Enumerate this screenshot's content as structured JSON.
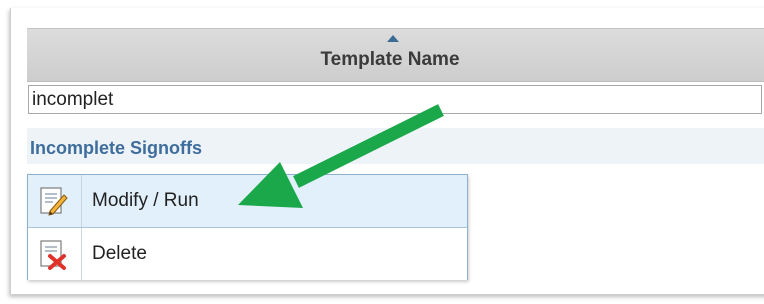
{
  "table": {
    "column_header": "Template Name",
    "sort_direction": "ascending",
    "filter_value": "incomplet",
    "rows": [
      {
        "label": "Incomplete Signoffs"
      }
    ]
  },
  "context_menu": {
    "items": [
      {
        "label": "Modify / Run",
        "icon": "edit-document-icon",
        "highlighted": true
      },
      {
        "label": "Delete",
        "icon": "delete-document-icon",
        "highlighted": false
      }
    ]
  },
  "annotation": {
    "arrow_color": "#1aa84a"
  },
  "colors": {
    "header_bg": "#d3d3d3",
    "link": "#3f6e9c",
    "menu_highlight": "#e2f0fb",
    "sort_arrow": "#3c6b94"
  }
}
